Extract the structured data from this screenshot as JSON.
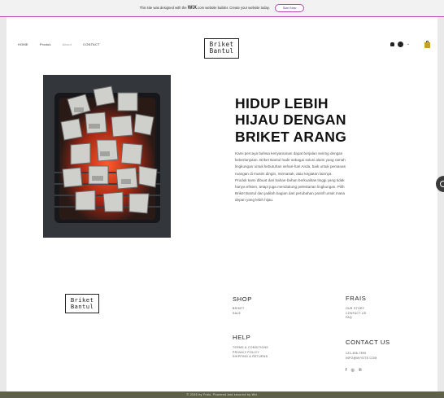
{
  "wix_banner": {
    "text_before": "This site was designed with the",
    "logo": "WiX",
    "text_after": ".com website builder. Create your website today.",
    "cta": "Start Now"
  },
  "header": {
    "nav": [
      "HOME",
      "Produk",
      "About",
      "CONTACT"
    ],
    "logo_line1": "Briket",
    "logo_line2": "Bantul",
    "cart_color": "#c9a225"
  },
  "hero": {
    "title": "HIDUP LEBIH HIJAU DENGAN BRIKET ARANG",
    "paragraph1": "Kami percaya bahwa kenyamanan dapat berjalan seiring dengan keberlanjutan. Briket Bantul hadir sebagai solusi alami yang ramah lingkungan untuk kebutuhan sehari-hari Anda, baik untuk pemanas ruangan di musim dingin, memasak, atau kegiatan lainnya.",
    "paragraph2": "Produk kami dibuat dari bahan-bahan berkualitas tinggi yang tidak hanya efisien, tetapi juga mendukung pelestarian lingkungan. Pilih Briket Bantul dan jadilah bagian dari perubahan positif untuk masa depan yang lebih hijau.",
    "image_icon": "charcoal-briquettes-on-grill-image"
  },
  "footer": {
    "logo_line1": "Briket",
    "logo_line2": "Bantul",
    "shop": {
      "heading": "SHOP",
      "links": [
        "BRIKET",
        "SALE"
      ]
    },
    "frais": {
      "heading": "FRAIS",
      "links": [
        "OUR STORY",
        "CONTACT US",
        "FAQ"
      ]
    },
    "help": {
      "heading": "HELP",
      "links": [
        "TERMS & CONDITIONS",
        "PRIVACY POLICY",
        "SHIPPING & RETURNS"
      ]
    },
    "contact": {
      "heading": "CONTACT US",
      "lines": [
        "123-456-7890",
        "INFO@MYSITE.COM"
      ]
    },
    "social": [
      "f",
      "◎",
      "℗"
    ],
    "copyright": "© 2035 by Frais. Powered and secured by Wix",
    "bar_color": "#5f6148"
  }
}
